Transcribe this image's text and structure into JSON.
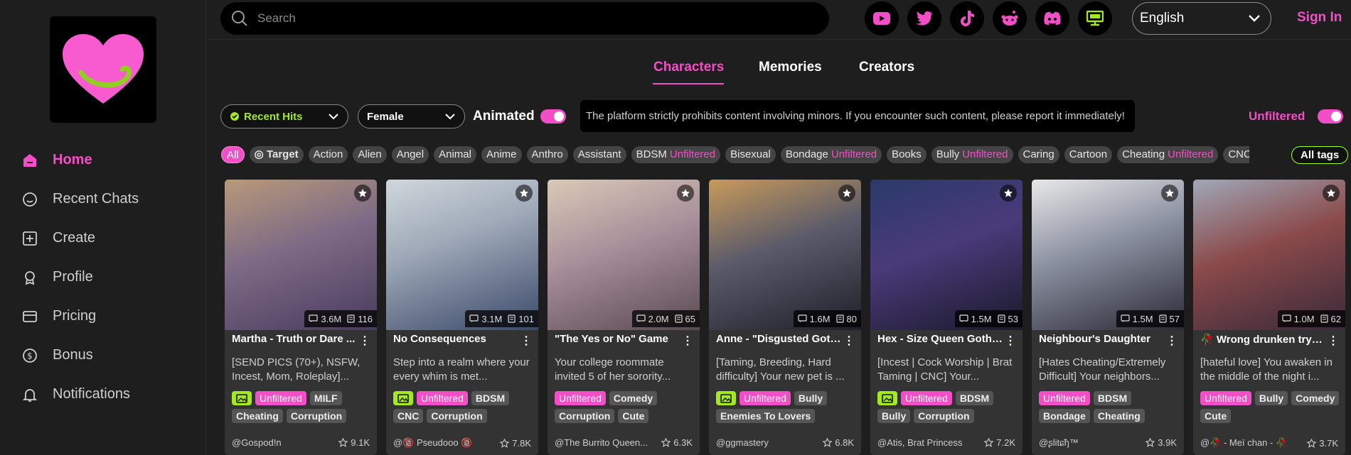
{
  "search": {
    "placeholder": "Search"
  },
  "social_icons": [
    "youtube-icon",
    "twitter-icon",
    "tiktok-icon",
    "reddit-icon",
    "discord-icon",
    "desktop-icon"
  ],
  "language": "English",
  "sign_in": "Sign In",
  "sidebar": {
    "items": [
      {
        "label": "Home",
        "icon": "home-icon"
      },
      {
        "label": "Recent Chats",
        "icon": "chat-icon"
      },
      {
        "label": "Create",
        "icon": "plus-square-icon"
      },
      {
        "label": "Profile",
        "icon": "profile-icon"
      },
      {
        "label": "Pricing",
        "icon": "card-icon"
      },
      {
        "label": "Bonus",
        "icon": "coin-icon"
      },
      {
        "label": "Notifications",
        "icon": "bell-icon"
      }
    ]
  },
  "tabs": [
    "Characters",
    "Memories",
    "Creators"
  ],
  "filters": {
    "sort": "Recent Hits",
    "gender": "Female",
    "animated_label": "Animated",
    "notice": "The platform strictly prohibits content involving minors. If you encounter such content, please report it immediately!",
    "unfiltered_label": "Unfiltered"
  },
  "tags": [
    {
      "label": "All"
    },
    {
      "label": "Target"
    },
    {
      "label": "Action"
    },
    {
      "label": "Alien"
    },
    {
      "label": "Angel"
    },
    {
      "label": "Animal"
    },
    {
      "label": "Anime"
    },
    {
      "label": "Anthro"
    },
    {
      "label": "Assistant"
    },
    {
      "label": "BDSM",
      "suffix": "Unfiltered"
    },
    {
      "label": "Bisexual"
    },
    {
      "label": "Bondage",
      "suffix": "Unfiltered"
    },
    {
      "label": "Books"
    },
    {
      "label": "Bully",
      "suffix": "Unfiltered"
    },
    {
      "label": "Caring"
    },
    {
      "label": "Cartoon"
    },
    {
      "label": "Cheating",
      "suffix": "Unfiltered"
    },
    {
      "label": "CNC"
    }
  ],
  "all_tags_label": "All tags",
  "cards": [
    {
      "title": "Martha - Truth or Dare ...",
      "description": "[SEND PICS (70+), NSFW, Incest, Mom, Roleplay]...",
      "chats": "3.6M",
      "memories": "116",
      "image_tag": true,
      "tags": [
        "Unfiltered",
        "MILF",
        "Cheating",
        "Corruption"
      ],
      "creator": "@Gospod!n",
      "likes": "9.1K"
    },
    {
      "title": "No Consequences",
      "description": "Step into a realm where your every whim is met...",
      "chats": "3.1M",
      "memories": "101",
      "image_tag": true,
      "tags": [
        "Unfiltered",
        "BDSM",
        "CNC",
        "Corruption"
      ],
      "creator": "@🔞 Pseudooo 🔞",
      "likes": "7.8K"
    },
    {
      "title": "\"The Yes or No\" Game",
      "description": "Your college roommate invited 5 of her sorority...",
      "chats": "2.0M",
      "memories": "65",
      "image_tag": false,
      "tags": [
        "Unfiltered",
        "Comedy",
        "Corruption",
        "Cute"
      ],
      "creator": "@The Burrito Queen...",
      "likes": "6.3K"
    },
    {
      "title": "Anne - \"Disgusted Goth...",
      "description": "[Taming, Breeding, Hard difficulty] Your new pet is ...",
      "chats": "1.6M",
      "memories": "80",
      "image_tag": true,
      "tags": [
        "Unfiltered",
        "Bully",
        "Enemies To Lovers"
      ],
      "creator": "@ggmastery",
      "likes": "6.8K"
    },
    {
      "title": "Hex - Size Queen Goth ...",
      "description": "[Incest | Cock Worship | Brat Taming | CNC] Your...",
      "chats": "1.5M",
      "memories": "53",
      "image_tag": true,
      "tags": [
        "Unfiltered",
        "BDSM",
        "Bully",
        "Corruption"
      ],
      "creator": "@Atis, Brat Princess",
      "likes": "7.2K"
    },
    {
      "title": "Neighbour's Daughter",
      "description": "[Hates Cheating/Extremely Difficult] Your neighbors...",
      "chats": "1.5M",
      "memories": "57",
      "image_tag": false,
      "tags": [
        "Unfiltered",
        "BDSM",
        "Bondage",
        "Cheating"
      ],
      "creator": "@ʂlitɕђ™",
      "likes": "3.9K"
    },
    {
      "title": "🥀 Wrong drunken tryst...",
      "description": "[hateful love] You awaken in the middle of the night i...",
      "chats": "1.0M",
      "memories": "62",
      "image_tag": false,
      "tags": [
        "Unfiltered",
        "Bully",
        "Comedy",
        "Cute"
      ],
      "creator": "@🥀 - Meï chan - 🥀",
      "likes": "3.7K"
    }
  ],
  "colors": {
    "accent": "#f24fc7",
    "lime": "#a4e81f",
    "background": "#1e1e1e",
    "card": "#333333"
  }
}
